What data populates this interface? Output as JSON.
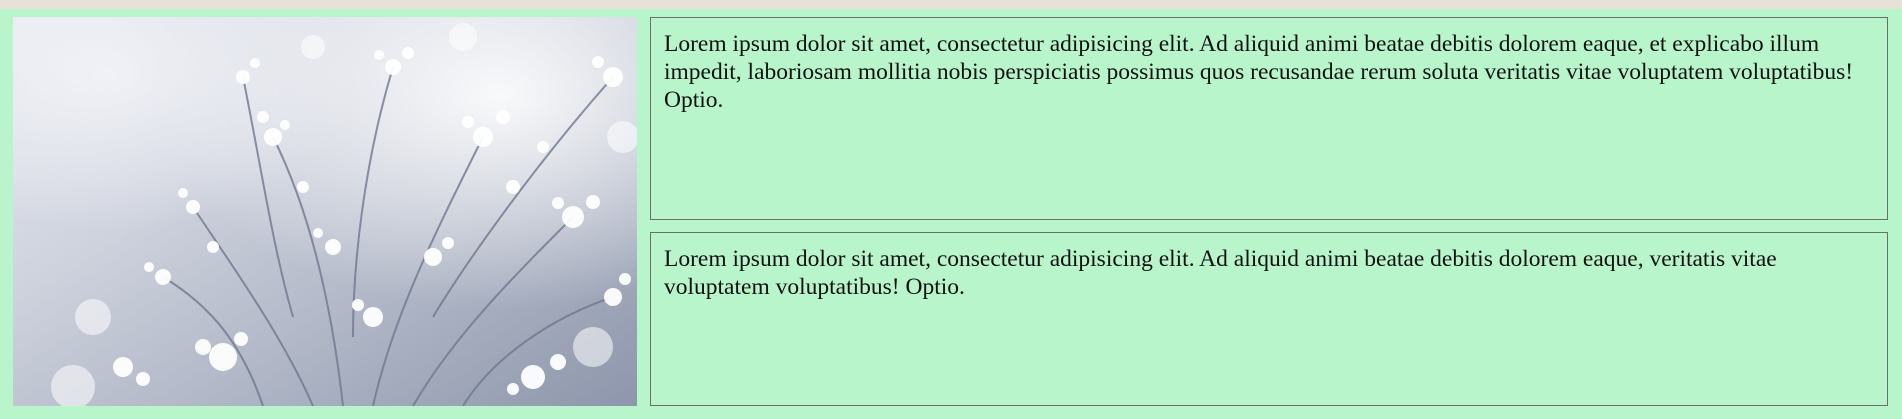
{
  "image": {
    "subject": "wildflowers-photo",
    "colors": {
      "background_light": "#dfe3ec",
      "background_dark": "#8f98ad",
      "flowers": "#ffffff"
    }
  },
  "cards": [
    {
      "text": "Lorem ipsum dolor sit amet, consectetur adipisicing elit. Ad aliquid animi beatae debitis dolorem eaque, et explicabo illum impedit, laboriosam mollitia nobis perspiciatis possimus quos recusandae rerum soluta veritatis vitae voluptatem voluptatibus! Optio."
    },
    {
      "text": "Lorem ipsum dolor sit amet, consectetur adipisicing elit. Ad aliquid animi beatae debitis dolorem eaque, veritatis vitae voluptatem voluptatibus! Optio."
    }
  ],
  "theme": {
    "page_bg": "#b8f5cb",
    "top_strip": "#e6e2d7",
    "border": "#6a6f6a",
    "text": "#111111"
  }
}
